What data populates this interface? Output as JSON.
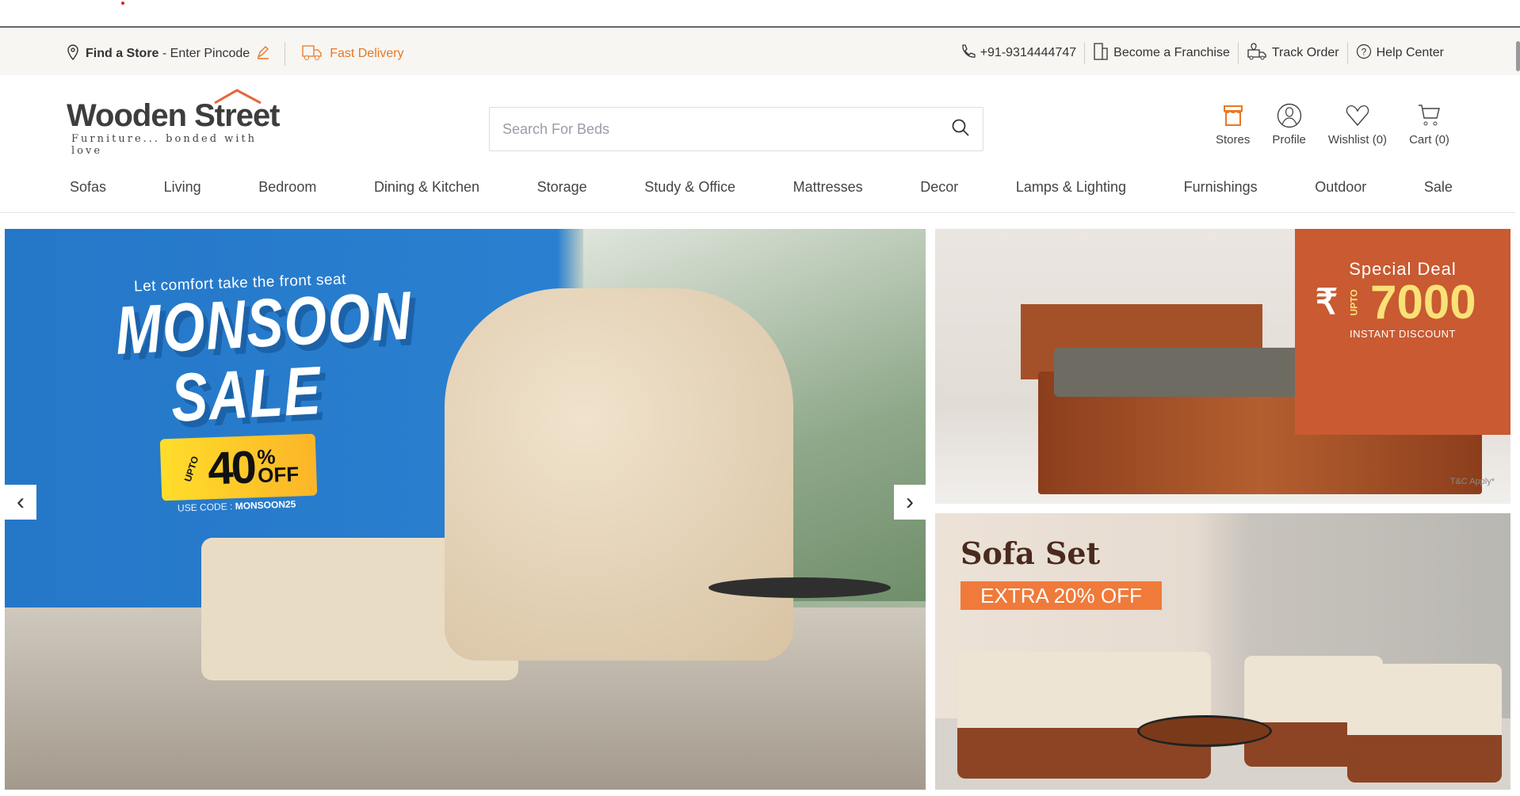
{
  "topbar": {
    "find_store": "Find a Store",
    "enter_pincode": "- Enter Pincode",
    "fast_delivery": "Fast Delivery",
    "phone": "+91-9314444747",
    "franchise": "Become a Franchise",
    "track_order": "Track Order",
    "help_center": "Help Center"
  },
  "logo": {
    "name": "Wooden Street",
    "tagline": "Furniture... bonded with love"
  },
  "search": {
    "placeholder": "Search For Beds",
    "value": ""
  },
  "header_icons": {
    "stores": "Stores",
    "profile": "Profile",
    "wishlist": "Wishlist (0)",
    "cart": "Cart (0)"
  },
  "nav": [
    "Sofas",
    "Living",
    "Bedroom",
    "Dining & Kitchen",
    "Storage",
    "Study & Office",
    "Mattresses",
    "Decor",
    "Lamps & Lighting",
    "Furnishings",
    "Outdoor",
    "Sale"
  ],
  "main_banner": {
    "subtitle": "Let comfort take the front seat",
    "title_line1": "MONSOON",
    "title_line2": "SALE",
    "upto": "UPTO",
    "discount": "40",
    "percent": "%",
    "off": "OFF",
    "code_label": "USE CODE : ",
    "code": "MONSOON25"
  },
  "bed_banner": {
    "heading": "Special Deal",
    "currency": "₹",
    "upto": "UPTO",
    "amount": "7000",
    "sub": "INSTANT DISCOUNT",
    "terms": "T&C Apply*"
  },
  "sofa_banner": {
    "title": "Sofa Set",
    "badge": "EXTRA 20% OFF"
  },
  "colors": {
    "accent": "#e87722",
    "topbar_bg": "#f7f6f2",
    "banner_blue": "#2577c8",
    "deal_bg": "#c95a32"
  }
}
